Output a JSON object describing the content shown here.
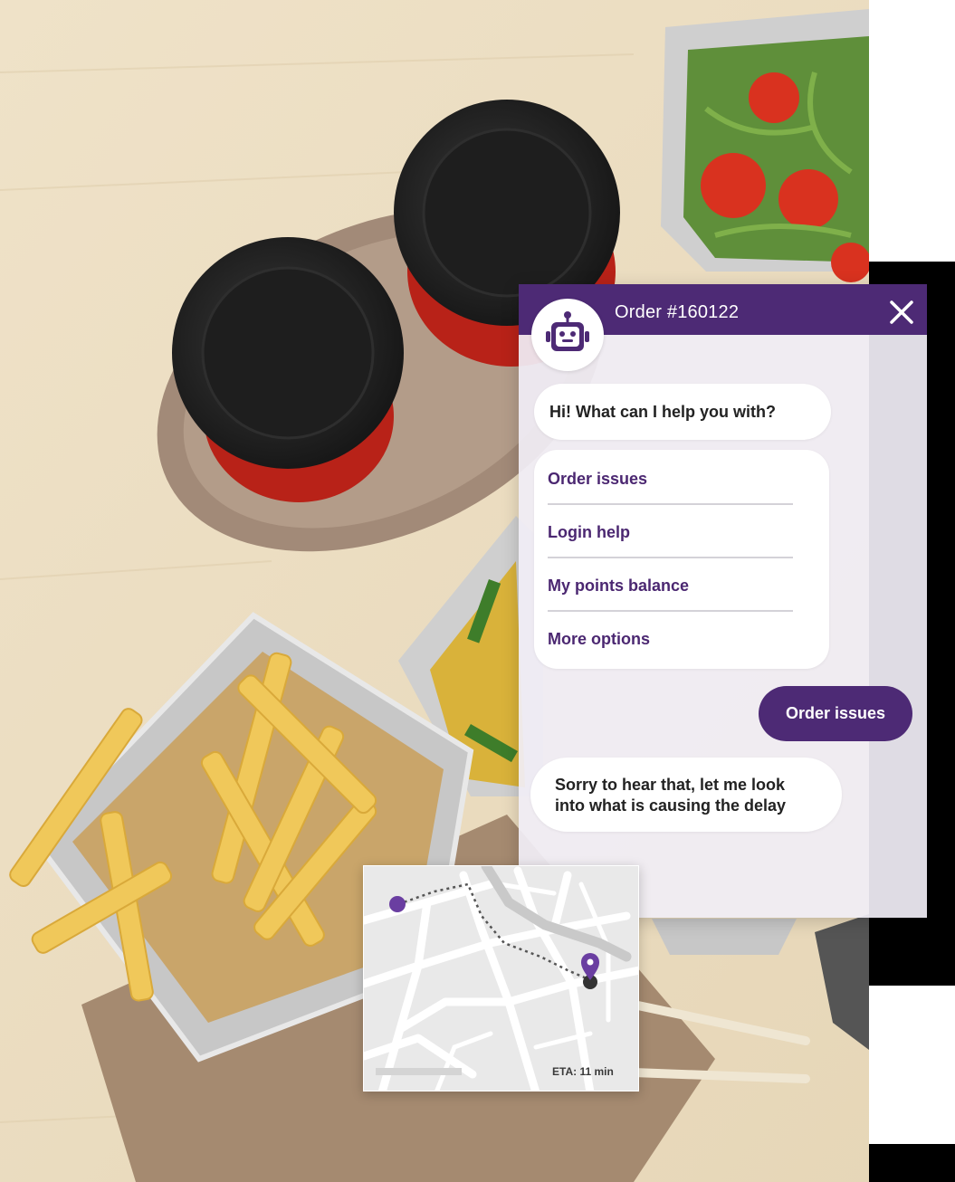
{
  "chat": {
    "header_title": "Order #160122",
    "greeting": "Hi! What can I help you with?",
    "options": [
      "Order issues",
      "Login help",
      "My points balance",
      "More options"
    ],
    "user_message": "Order issues",
    "bot_reply_lines": [
      "Sorry to hear that, let me look",
      "into what is causing the delay"
    ],
    "icons": {
      "avatar": "robot-icon",
      "close": "close-icon"
    }
  },
  "map": {
    "eta": "ETA: 11 min",
    "icons": {
      "origin": "origin-dot-icon",
      "destination": "location-pin-icon"
    }
  },
  "colors": {
    "brand_purple": "#4d2a75",
    "option_text": "#4b2771",
    "panel_bg": "#f0edf5",
    "map_route": "#555555"
  }
}
